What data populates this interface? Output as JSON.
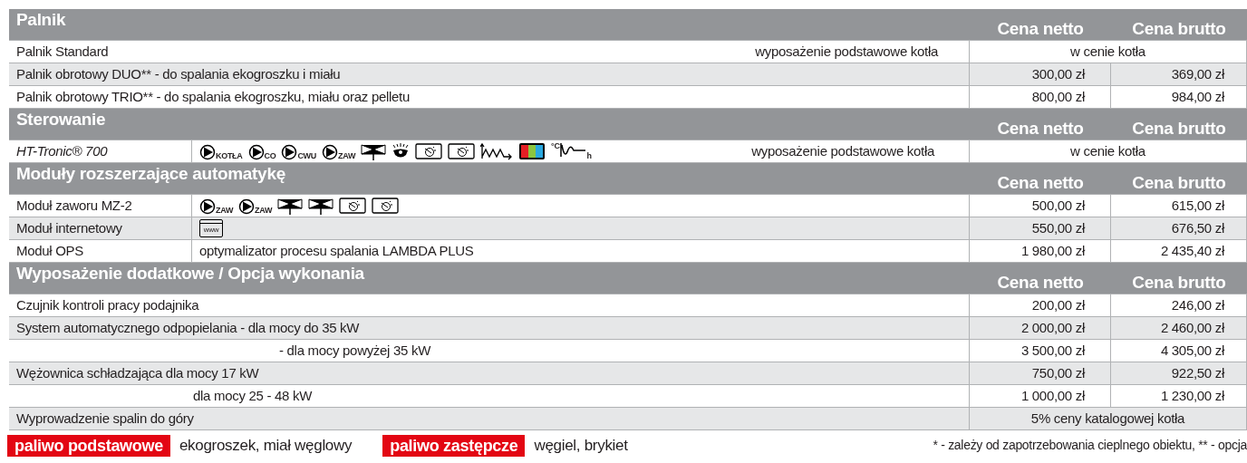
{
  "sections": [
    {
      "title": "Palnik",
      "columns": [
        "Cena netto",
        "Cena brutto"
      ],
      "name_divider": false,
      "rows": [
        {
          "name": "Palnik Standard",
          "description": "wyposażenie podstawowe kotła",
          "price_note": "w cenie kotła"
        },
        {
          "name": "Palnik obrotowy DUO** - do spalania ekogroszku i miału",
          "netto": "300,00 zł",
          "brutto": "369,00 zł"
        },
        {
          "name": "Palnik obrotowy TRIO** - do spalania ekogroszku, miału oraz pelletu",
          "netto": "800,00 zł",
          "brutto": "984,00 zł"
        }
      ]
    },
    {
      "title": "Sterowanie",
      "columns": [
        "Cena netto",
        "Cena brutto"
      ],
      "name_divider": true,
      "rows": [
        {
          "name": "HT-Tronic® 700",
          "italic": true,
          "icons": [
            {
              "kind": "pump",
              "label": "KOTŁA"
            },
            {
              "kind": "pump",
              "label": "CO"
            },
            {
              "kind": "pump",
              "label": "CWU"
            },
            {
              "kind": "pump",
              "label": "ZAW"
            },
            {
              "kind": "valve"
            },
            {
              "kind": "burner"
            },
            {
              "kind": "thermostat"
            },
            {
              "kind": "thermostat"
            },
            {
              "kind": "buffer"
            },
            {
              "kind": "display"
            },
            {
              "kind": "curve",
              "label": "°C",
              "unit": "h"
            }
          ],
          "description": "wyposażenie podstawowe kotła",
          "price_note": "w cenie kotła"
        }
      ]
    },
    {
      "title": "Moduły rozszerzające automatykę",
      "columns": [
        "Cena netto",
        "Cena brutto"
      ],
      "name_divider": true,
      "rows": [
        {
          "name": "Moduł zaworu MZ-2",
          "icons": [
            {
              "kind": "pump",
              "label": "ZAW"
            },
            {
              "kind": "pump",
              "label": "ZAW"
            },
            {
              "kind": "valve"
            },
            {
              "kind": "valve"
            },
            {
              "kind": "thermostat"
            },
            {
              "kind": "thermostat"
            }
          ],
          "netto": "500,00 zł",
          "brutto": "615,00 zł"
        },
        {
          "name": "Moduł internetowy",
          "icons": [
            {
              "kind": "web",
              "label": "www"
            }
          ],
          "netto": "550,00 zł",
          "brutto": "676,50 zł"
        },
        {
          "name": "Moduł OPS",
          "description": "optymalizator procesu spalania LAMBDA PLUS",
          "netto": "1 980,00 zł",
          "brutto": "2 435,40 zł"
        }
      ]
    },
    {
      "title": "Wyposażenie dodatkowe / Opcja wykonania",
      "columns": [
        "Cena netto",
        "Cena brutto"
      ],
      "name_divider": false,
      "rows": [
        {
          "kind": "item",
          "name": "Czujnik kontroli pracy podajnika",
          "netto": "200,00 zł",
          "brutto": "246,00 zł"
        },
        {
          "kind": "item",
          "name": "System automatycznego odpopielania - dla mocy do 35 kW",
          "netto": "2 000,00 zł",
          "brutto": "2 460,00 zł"
        },
        {
          "kind": "sub_long",
          "sub": "- dla mocy powyżej 35 kW",
          "netto": "3 500,00 zł",
          "brutto": "4 305,00 zł"
        },
        {
          "kind": "item",
          "name": "Wężownica schładzająca  dla mocy 17 kW",
          "netto": "750,00 zł",
          "brutto": "922,50 zł"
        },
        {
          "kind": "sub_short",
          "sub": "dla mocy 25 - 48 kW",
          "netto": "1 000,00 zł",
          "brutto": "1 230,00 zł"
        },
        {
          "kind": "item",
          "name": "Wyprowadzenie spalin do góry",
          "price_note": "5% ceny katalogowej kotła"
        }
      ]
    }
  ],
  "footer": {
    "fuels": [
      {
        "label": "paliwo podstawowe",
        "value": "ekogroszek, miał węglowy"
      },
      {
        "label": "paliwo zastępcze",
        "value": "węgiel, brykiet"
      }
    ],
    "footnote": "* - zależy od zapotrzebowania cieplnego obiektu, ** - opcja"
  }
}
